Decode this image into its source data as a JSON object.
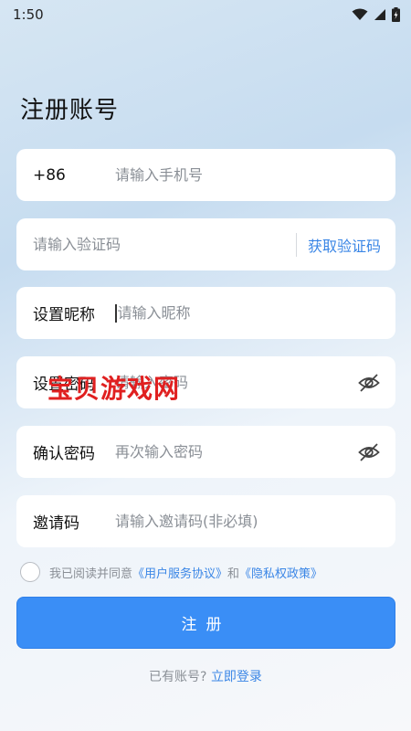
{
  "status_bar": {
    "time": "1:50",
    "icons": [
      "wifi-icon",
      "signal-icon",
      "battery-icon"
    ]
  },
  "page": {
    "title": "注册账号"
  },
  "form": {
    "phone": {
      "prefix": "+86",
      "placeholder": "请输入手机号"
    },
    "code": {
      "placeholder": "请输入验证码",
      "button_label": "获取验证码"
    },
    "nickname": {
      "label": "设置昵称",
      "placeholder": "请输入昵称"
    },
    "password": {
      "label": "设置密码",
      "placeholder": "请输入密码"
    },
    "confirm": {
      "label": "确认密码",
      "placeholder": "再次输入密码"
    },
    "invite": {
      "label": "邀请码",
      "placeholder": "请输入邀请码(非必填)"
    }
  },
  "watermark": "宝贝游戏网",
  "agreement": {
    "prefix": "我已阅读并同意",
    "user_agreement": "《用户服务协议》",
    "and": "和",
    "privacy_policy": "《隐私权政策》"
  },
  "register_button": "注册",
  "login": {
    "prompt": "已有账号?",
    "link": "立即登录"
  },
  "colors": {
    "accent": "#3a86e6",
    "button": "#3a8ef6",
    "watermark": "#e02020"
  }
}
